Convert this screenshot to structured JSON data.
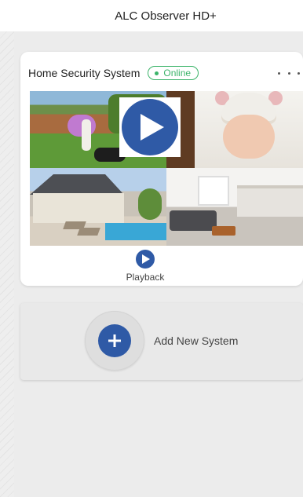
{
  "app": {
    "title": "ALC Observer HD+"
  },
  "system": {
    "name": "Home Security System",
    "status": "Online",
    "status_color": "#3cb46a",
    "menu_icon": "more-horizontal-icon",
    "cameras": [
      {
        "name": "backyard-camera"
      },
      {
        "name": "nursery-camera"
      },
      {
        "name": "pool-camera"
      },
      {
        "name": "living-room-camera"
      }
    ],
    "play_icon": "play-icon",
    "playback_label": "Playback"
  },
  "add_system": {
    "label": "Add New System",
    "icon": "plus-icon"
  },
  "colors": {
    "accent": "#2f5aa6",
    "background": "#ececec"
  }
}
